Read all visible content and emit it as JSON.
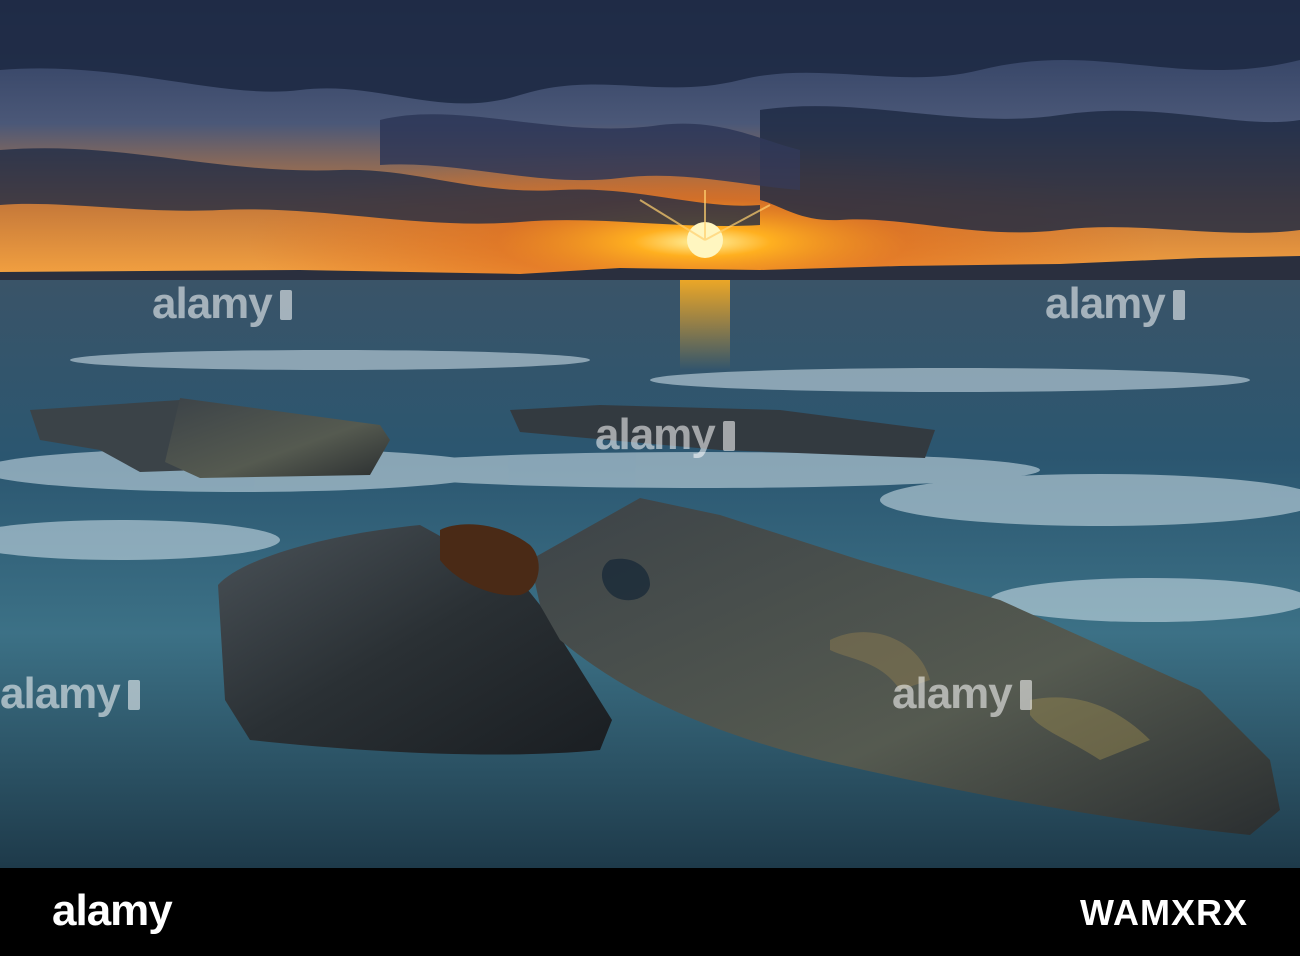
{
  "watermark": {
    "text": "alamy"
  },
  "footer": {
    "logo": "alamy",
    "image_id": "WAMXRX"
  },
  "colors": {
    "sky_dark": "#1c2a44",
    "sun": "#ffb020",
    "sea": "#1f4a60",
    "rock": "#2e3438",
    "footer_bg": "#000000"
  }
}
